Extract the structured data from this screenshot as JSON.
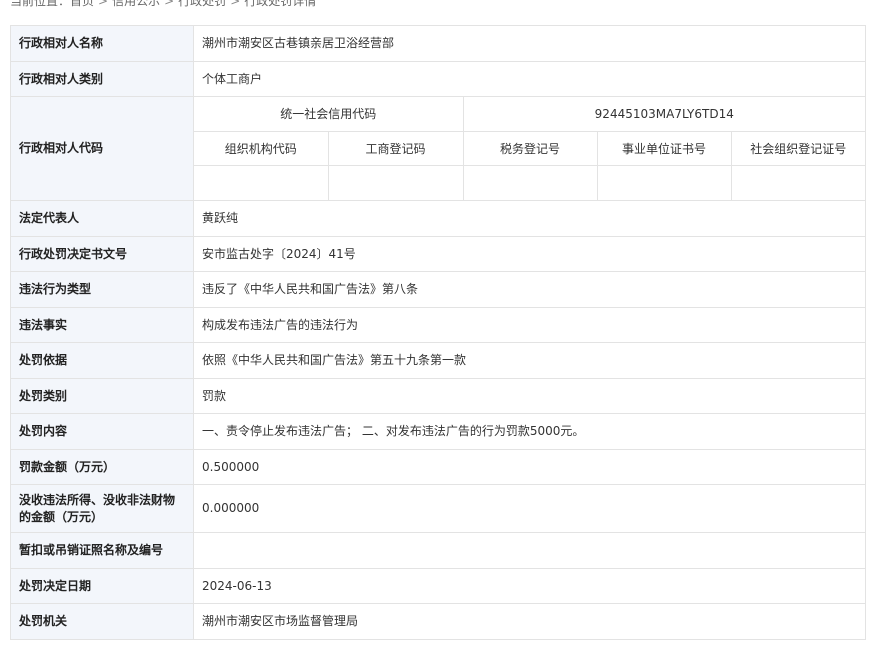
{
  "breadcrumb": {
    "prefix": "当前位置：",
    "items": [
      "首页",
      "信用公示",
      "行政处罚",
      "行政处罚详情"
    ],
    "separator": ">"
  },
  "labels": {
    "name": "行政相对人名称",
    "category": "行政相对人类别",
    "code": "行政相对人代码",
    "legal_rep": "法定代表人",
    "doc_no": "行政处罚决定书文号",
    "violation_type": "违法行为类型",
    "violation_fact": "违法事实",
    "basis": "处罚依据",
    "penalty_type": "处罚类别",
    "penalty_content": "处罚内容",
    "fine_amount": "罚款金额（万元）",
    "confiscation_amount": "没收违法所得、没收非法财物的金额（万元）",
    "license_revoked": "暂扣或吊销证照名称及编号",
    "decision_date": "处罚决定日期",
    "authority": "处罚机关"
  },
  "values": {
    "name": "潮州市潮安区古巷镇亲居卫浴经营部",
    "category": "个体工商户",
    "legal_rep": "黄跃纯",
    "doc_no": "安市监古处字〔2024〕41号",
    "violation_type": "违反了《中华人民共和国广告法》第八条",
    "violation_fact": "构成发布违法广告的违法行为",
    "basis": "依照《中华人民共和国广告法》第五十九条第一款",
    "penalty_type": "罚款",
    "penalty_content": "一、责令停止发布违法广告； 二、对发布违法广告的行为罚款5000元。",
    "fine_amount": "0.500000",
    "confiscation_amount": "0.000000",
    "license_revoked": "",
    "decision_date": "2024-06-13",
    "authority": "潮州市潮安区市场监督管理局"
  },
  "code_table": {
    "uscc_label": "统一社会信用代码",
    "uscc_value": "92445103MA7LY6TD14",
    "headers": [
      "组织机构代码",
      "工商登记码",
      "税务登记号",
      "事业单位证书号",
      "社会组织登记证号"
    ],
    "values": [
      "",
      "",
      "",
      "",
      ""
    ]
  }
}
